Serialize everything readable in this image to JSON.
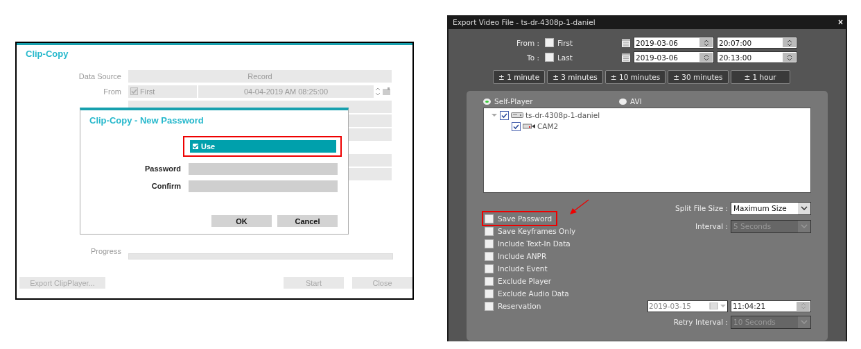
{
  "clip_copy": {
    "title": "Clip-Copy",
    "data_source": {
      "label": "Data Source",
      "value": "Record"
    },
    "from": {
      "label": "From",
      "checkbox_label": "First",
      "checked": true,
      "value": "04-04-2019  AM 08:25:00"
    },
    "progress": {
      "label": "Progress",
      "level": 0
    },
    "buttons": [
      {
        "label": "Export ClipPlayer...",
        "disabled": true
      },
      {
        "label": "Start",
        "disabled": true
      },
      {
        "label": "Close",
        "disabled": true
      }
    ]
  },
  "new_password": {
    "title": "Clip-Copy - New Password",
    "use": {
      "label": "Use",
      "checked": true,
      "highlighted": true
    },
    "fields": [
      {
        "label": "Password"
      },
      {
        "label": "Confirm"
      }
    ],
    "buttons": [
      "OK",
      "Cancel"
    ]
  },
  "export": {
    "title": "Export Video File - ts-dr-4308p-1-daniel",
    "close": "×",
    "range": [
      {
        "label": "From :",
        "checkbox_label": "First",
        "checked": false,
        "date": "2019-03-06",
        "time": "20:07:00"
      },
      {
        "label": "To :",
        "checkbox_label": "Last",
        "checked": false,
        "date": "2019-03-06",
        "time": "20:13:00"
      }
    ],
    "offset_buttons": [
      "± 1 minute",
      "± 3 minutes",
      "± 10 minutes",
      "± 30 minutes",
      "± 1 hour"
    ],
    "formats": [
      {
        "label": "Self-Player",
        "selected": true
      },
      {
        "label": "AVI",
        "selected": false
      }
    ],
    "tree": [
      {
        "label": "ts-dr-4308p-1-daniel",
        "kind": "recorder",
        "checked": true,
        "expanded": true,
        "children": [
          {
            "label": "CAM2",
            "kind": "camera",
            "checked": true
          }
        ]
      }
    ],
    "options": [
      {
        "label": "Save Password",
        "checked": false,
        "highlighted": true
      },
      {
        "label": "Save Keyframes Only",
        "checked": false,
        "highlighted": false
      },
      {
        "label": "Include Text-In Data",
        "checked": false,
        "highlighted": false
      },
      {
        "label": "Include ANPR",
        "checked": false,
        "highlighted": false
      },
      {
        "label": "Include Event",
        "checked": false,
        "highlighted": false
      },
      {
        "label": "Exclude Player",
        "checked": false,
        "highlighted": false
      },
      {
        "label": "Exclude Audio Data",
        "checked": false,
        "highlighted": false
      },
      {
        "label": "Reservation",
        "checked": false,
        "highlighted": false
      }
    ],
    "split_file_size": {
      "label": "Split File Size :",
      "value": "Maximum Size",
      "disabled": false
    },
    "interval": {
      "label": "Interval :",
      "value": "5 Seconds",
      "disabled": true
    },
    "reservation": {
      "date": "2019-03-15",
      "time": "11:04:21"
    },
    "retry_interval": {
      "label": "Retry Interval :",
      "value": "10 Seconds",
      "disabled": true
    }
  }
}
